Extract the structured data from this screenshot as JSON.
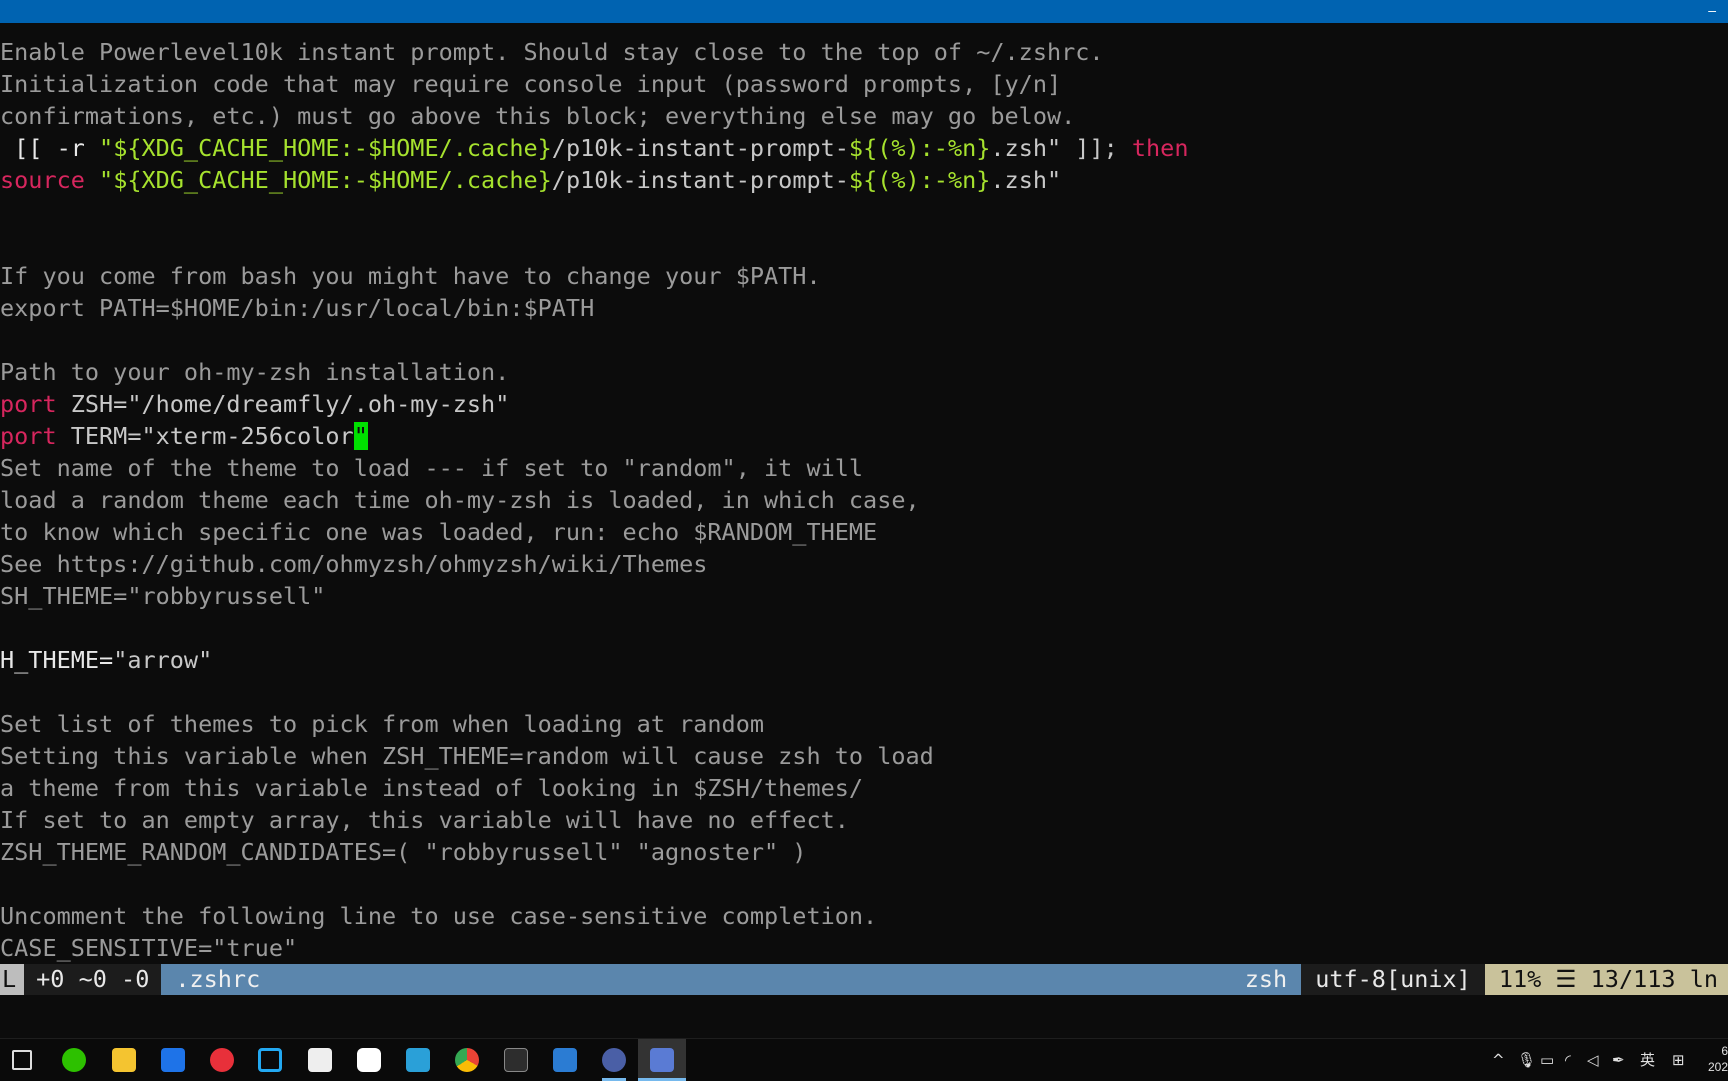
{
  "window": {
    "titlebar_glyph": "–"
  },
  "editor": {
    "lines": {
      "l1": "Enable Powerlevel10k instant prompt. Should stay close to the top of ~/.zshrc.",
      "l2": "Initialization code that may require console input (password prompts, [y/n]",
      "l3": "confirmations, etc.) must go above this block; everything else may go below.",
      "l4": {
        "a": " [[ -r ",
        "b": "\"${XDG_CACHE_HOME:-$HOME/.cache}",
        "c": "/p10k-instant-prompt-",
        "d": "${(%):-%n}",
        "e": ".zsh\" ]]; ",
        "f": "then"
      },
      "l5": {
        "a": "source",
        "b": " ",
        "c": "\"${XDG_CACHE_HOME:-$HOME/.cache}",
        "d": "/p10k-instant-prompt-",
        "e": "${(%):-%n}",
        "f": ".zsh\""
      },
      "l8": "If you come from bash you might have to change your $PATH.",
      "l9": "export PATH=$HOME/bin:/usr/local/bin:$PATH",
      "l11": "Path to your oh-my-zsh installation.",
      "l12": {
        "kw": "port",
        "rest": " ZSH=\"/home/dreamfly/.oh-my-zsh\""
      },
      "l13": {
        "kw": "port",
        "rest": " TERM=\"xterm-256color",
        "cursor": "\""
      },
      "l14": "Set name of the theme to load --- if set to \"random\", it will",
      "l15": "load a random theme each time oh-my-zsh is loaded, in which case,",
      "l16": "to know which specific one was loaded, run: echo $RANDOM_THEME",
      "l17": "See https://github.com/ohmyzsh/ohmyzsh/wiki/Themes",
      "l18": "SH_THEME=\"robbyrussell\"",
      "l20": {
        "a": "H_THEME=",
        "b": "\"arrow\""
      },
      "l22": "Set list of themes to pick from when loading at random",
      "l23": "Setting this variable when ZSH_THEME=random will cause zsh to load",
      "l24": "a theme from this variable instead of looking in $ZSH/themes/",
      "l25": "If set to an empty array, this variable will have no effect.",
      "l26": "ZSH_THEME_RANDOM_CANDIDATES=( \"robbyrussell\" \"agnoster\" )",
      "l28": "Uncomment the following line to use case-sensitive completion.",
      "l29": "CASE_SENSITIVE=\"true\""
    }
  },
  "statusline": {
    "mode": "L",
    "diff": "+0 ~0 -0",
    "filename": ".zshrc",
    "filetype": "zsh",
    "encoding": "utf-8[unix]",
    "position": "11% ☰ 13/113 ln"
  },
  "taskbar": {
    "tray_caret": "^",
    "ime": "英",
    "clock_line1": "6",
    "clock_line2": "202"
  },
  "colors": {
    "titlebar": "#0063b1",
    "keyword": "#d7265e",
    "string": "#a6e22e",
    "cursor": "#00e000",
    "statusline_file": "#5b86ad",
    "statusline_position": "#c9c29b"
  }
}
